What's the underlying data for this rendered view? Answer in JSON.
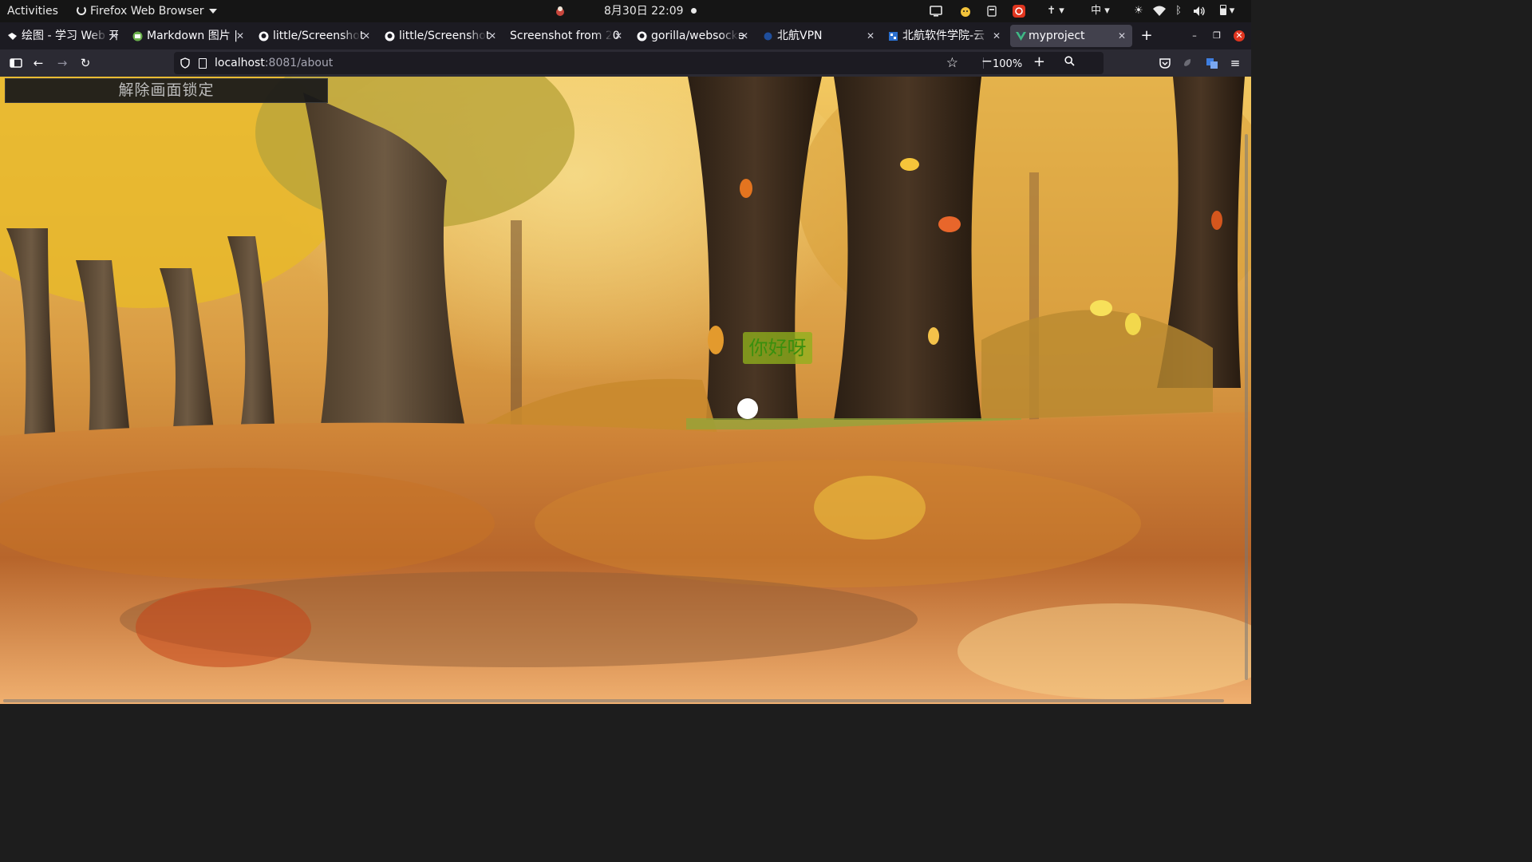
{
  "system_bar": {
    "activities": "Activities",
    "app_name": "Firefox Web Browser",
    "clock": "8月30日  22:09",
    "tray_icons": [
      "display-icon",
      "mascot-icon",
      "storage-icon",
      "netease-music-icon",
      "accessibility-icon",
      "input-method-icon",
      "brightness-icon",
      "wifi-icon",
      "bluetooth-icon",
      "volume-icon",
      "battery-icon"
    ],
    "input_method": "中"
  },
  "tabs": [
    {
      "title": "绘图 - 学习 Web 开",
      "icon": "drawing-app-icon"
    },
    {
      "title": "Markdown 图片 |",
      "icon": "markdown-site-icon"
    },
    {
      "title": "little/Screenshot",
      "icon": "github-icon"
    },
    {
      "title": "little/Screenshot",
      "icon": "github-icon"
    },
    {
      "title": "Screenshot from 20",
      "icon": ""
    },
    {
      "title": "gorilla/websocke",
      "icon": "github-icon"
    },
    {
      "title": "北航VPN",
      "icon": "buaa-vpn-icon"
    },
    {
      "title": "北航软件学院-云",
      "icon": "buaa-cloud-icon"
    },
    {
      "title": "myproject",
      "icon": "vue-icon",
      "active": true
    }
  ],
  "toolbar": {
    "url_host": "localhost",
    "url_path": ":8081/about",
    "zoom_level": "100%"
  },
  "page": {
    "unlock_button": "解除画面锁定",
    "greeting": "你好呀"
  },
  "colors": {
    "topbar_bg": "#151515",
    "tabstrip_bg": "#1c1b22",
    "navbar_bg": "#2b2a33",
    "active_tab_bg": "#42414d",
    "greeting_bg": "#8faf1c",
    "greeting_text": "#3a8f0e",
    "close_button": "#e0351f"
  }
}
